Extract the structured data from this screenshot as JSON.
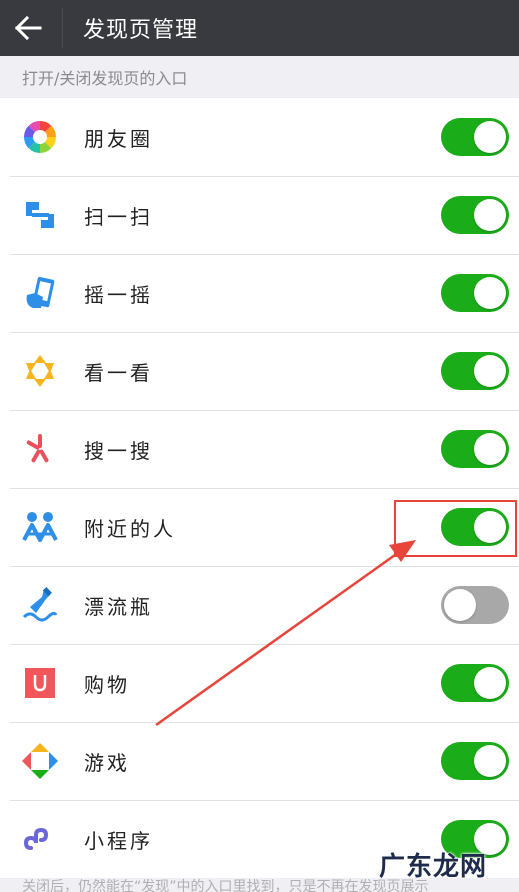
{
  "header": {
    "title": "发现页管理"
  },
  "section_hint": "打开/关闭发现页的入口",
  "items": [
    {
      "label": "朋友圈",
      "icon": "moments-icon",
      "enabled": true
    },
    {
      "label": "扫一扫",
      "icon": "scan-icon",
      "enabled": true
    },
    {
      "label": "摇一摇",
      "icon": "shake-icon",
      "enabled": true
    },
    {
      "label": "看一看",
      "icon": "top-stories-icon",
      "enabled": true
    },
    {
      "label": "搜一搜",
      "icon": "search-icon",
      "enabled": true
    },
    {
      "label": "附近的人",
      "icon": "people-nearby-icon",
      "enabled": true
    },
    {
      "label": "漂流瓶",
      "icon": "drift-bottle-icon",
      "enabled": false
    },
    {
      "label": "购物",
      "icon": "shopping-icon",
      "enabled": true
    },
    {
      "label": "游戏",
      "icon": "games-icon",
      "enabled": true
    },
    {
      "label": "小程序",
      "icon": "mini-programs-icon",
      "enabled": true
    }
  ],
  "bottom_hint": "关闭后，仍然能在“发现”中的入口里找到，只是不再在发现页展示",
  "watermark": "广东龙网",
  "colors": {
    "header_bg": "#393a3f",
    "toggle_on": "#1aad19",
    "toggle_off": "#a8a8a8",
    "annotation_red": "#e8443a"
  }
}
